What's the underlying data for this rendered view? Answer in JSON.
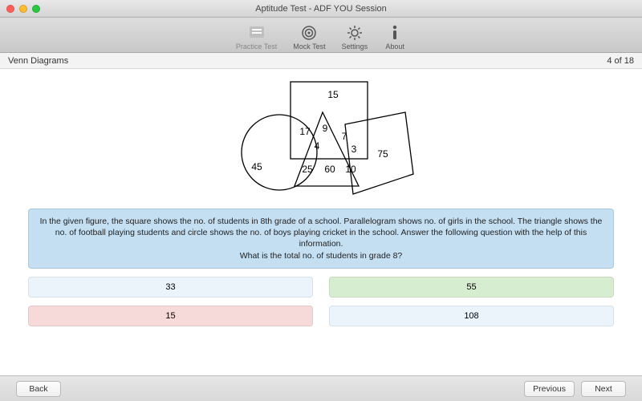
{
  "window": {
    "title": "Aptitude Test - ADF YOU Session"
  },
  "toolbar": {
    "practice": "Practice Test",
    "mock": "Mock Test",
    "settings": "Settings",
    "about": "About"
  },
  "page": {
    "section": "Venn Diagrams",
    "progress": "4 of 18"
  },
  "diagram": {
    "square_top": "15",
    "sq_tri": "9",
    "sq_tri_circ": "4",
    "sq_circ": "17",
    "sq_tri_para": "7",
    "sq_para": "3",
    "circ_only": "45",
    "circ_tri": "25",
    "tri_only": "60",
    "tri_para": "10",
    "para_only": "75"
  },
  "question": {
    "line1": "In the given figure, the square shows the no. of students in 8th grade of a school. Parallelogram shows no. of girls in the school. The triangle shows the no. of football playing students and circle shows the no. of boys playing cricket in the school. Answer the following question with the help of this information.",
    "line2": "What is the total no. of students in grade 8?"
  },
  "answers": {
    "a": "33",
    "b": "55",
    "c": "15",
    "d": "108"
  },
  "footer": {
    "back": "Back",
    "prev": "Previous",
    "next": "Next"
  },
  "chart_data": {
    "type": "table",
    "title": "Venn diagram region values",
    "regions": [
      {
        "region": "square only (top)",
        "value": 15
      },
      {
        "region": "square ∩ circle",
        "value": 17
      },
      {
        "region": "square ∩ triangle",
        "value": 9
      },
      {
        "region": "square ∩ triangle ∩ circle",
        "value": 4
      },
      {
        "region": "square ∩ triangle ∩ parallelogram",
        "value": 7
      },
      {
        "region": "square ∩ parallelogram",
        "value": 3
      },
      {
        "region": "circle only",
        "value": 45
      },
      {
        "region": "circle ∩ triangle",
        "value": 25
      },
      {
        "region": "triangle only",
        "value": 60
      },
      {
        "region": "triangle ∩ parallelogram",
        "value": 10
      },
      {
        "region": "parallelogram only",
        "value": 75
      }
    ]
  }
}
